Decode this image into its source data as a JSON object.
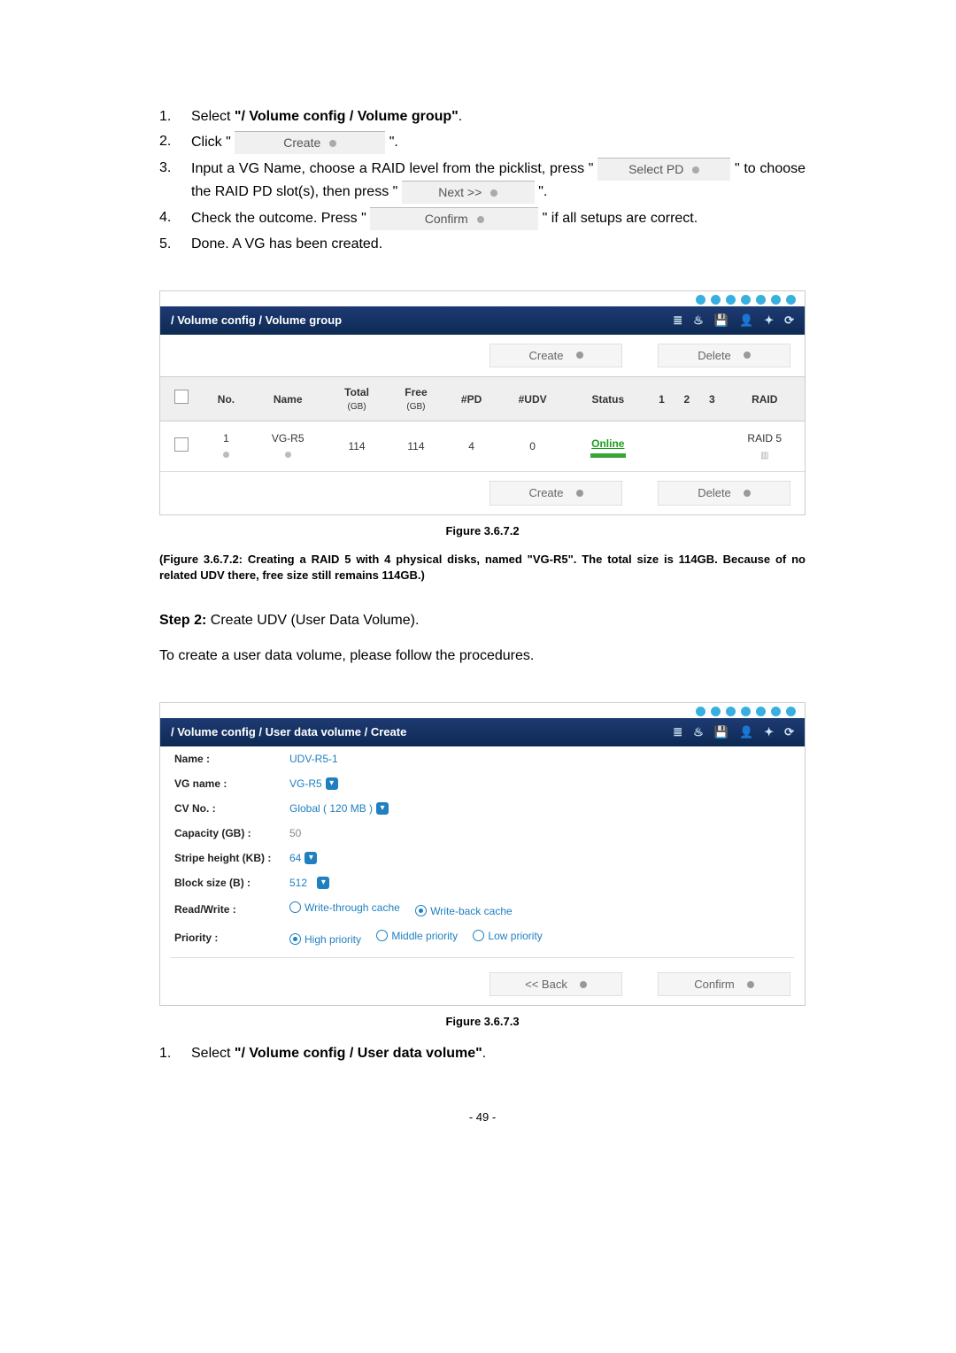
{
  "instructions1": {
    "n1": "1.",
    "t1a": "Select ",
    "t1b": "\"/ Volume config / Volume group\"",
    "t1c": ".",
    "n2": "2.",
    "t2a": "Click \" ",
    "btn_create_inline": "Create",
    "t2b": " \".",
    "n3": "3.",
    "t3a": "Input  a  VG  Name,  choose  a  RAID  level  from  the  picklist,  press \" ",
    "btn_selectpd": "Select PD",
    "t3b": " \"  to  choose  the  RAID  PD  slot(s),  then  press \" ",
    "btn_next": "Next >>",
    "t3c": " \".",
    "n4": "4.",
    "t4a": "Check  the  outcome.  Press  \" ",
    "btn_confirm_inline": "Confirm",
    "t4b": " \"  if  all  setups  are correct.",
    "n5": "5.",
    "t5": "Done. A VG has been created."
  },
  "panel1": {
    "breadcrumb": "/ Volume config / Volume group",
    "btn_create": "Create",
    "btn_delete": "Delete",
    "cols": {
      "no": "No.",
      "name": "Name",
      "total": "Total",
      "total_sub": "(GB)",
      "free": "Free",
      "free_sub": "(GB)",
      "pd": "#PD",
      "udv": "#UDV",
      "status": "Status",
      "c1": "1",
      "c2": "2",
      "c3": "3",
      "raid": "RAID"
    },
    "row": {
      "no": "1",
      "name": "VG-R5",
      "total": "114",
      "free": "114",
      "pd": "4",
      "udv": "0",
      "status": "Online",
      "raid": "RAID 5"
    }
  },
  "fig1_caption": "Figure 3.6.7.2",
  "fig1_desc": "(Figure 3.6.7.2: Creating a RAID 5 with 4 physical disks, named \"VG-R5\". The total size is 114GB. Because of no related UDV there, free size still remains 114GB.)",
  "step2_label": "Step 2:",
  "step2_text": " Create UDV (User Data Volume).",
  "step2_sub": "To create a user data volume, please follow the procedures.",
  "panel2": {
    "breadcrumb": "/ Volume config / User data volume / Create",
    "fields": {
      "name_l": "Name :",
      "name_v": "UDV-R5-1",
      "vg_l": "VG name :",
      "vg_v": "VG-R5",
      "cv_l": "CV No. :",
      "cv_v": "Global ( 120 MB )",
      "cap_l": "Capacity (GB) :",
      "cap_v": "50",
      "stripe_l": "Stripe height (KB) :",
      "stripe_v": "64",
      "block_l": "Block size (B) :",
      "block_v": "512",
      "rw_l": "Read/Write :",
      "rw_a": "Write-through cache",
      "rw_b": "Write-back cache",
      "prio_l": "Priority :",
      "prio_a": "High priority",
      "prio_b": "Middle priority",
      "prio_c": "Low priority"
    },
    "btn_back": "<< Back",
    "btn_confirm": "Confirm"
  },
  "fig2_caption": "Figure 3.6.7.3",
  "instructions2": {
    "n1": "1.",
    "t1a": "Select ",
    "t1b": "\"/ Volume config / User data volume\"",
    "t1c": "."
  },
  "pagenum": "- 49 -"
}
